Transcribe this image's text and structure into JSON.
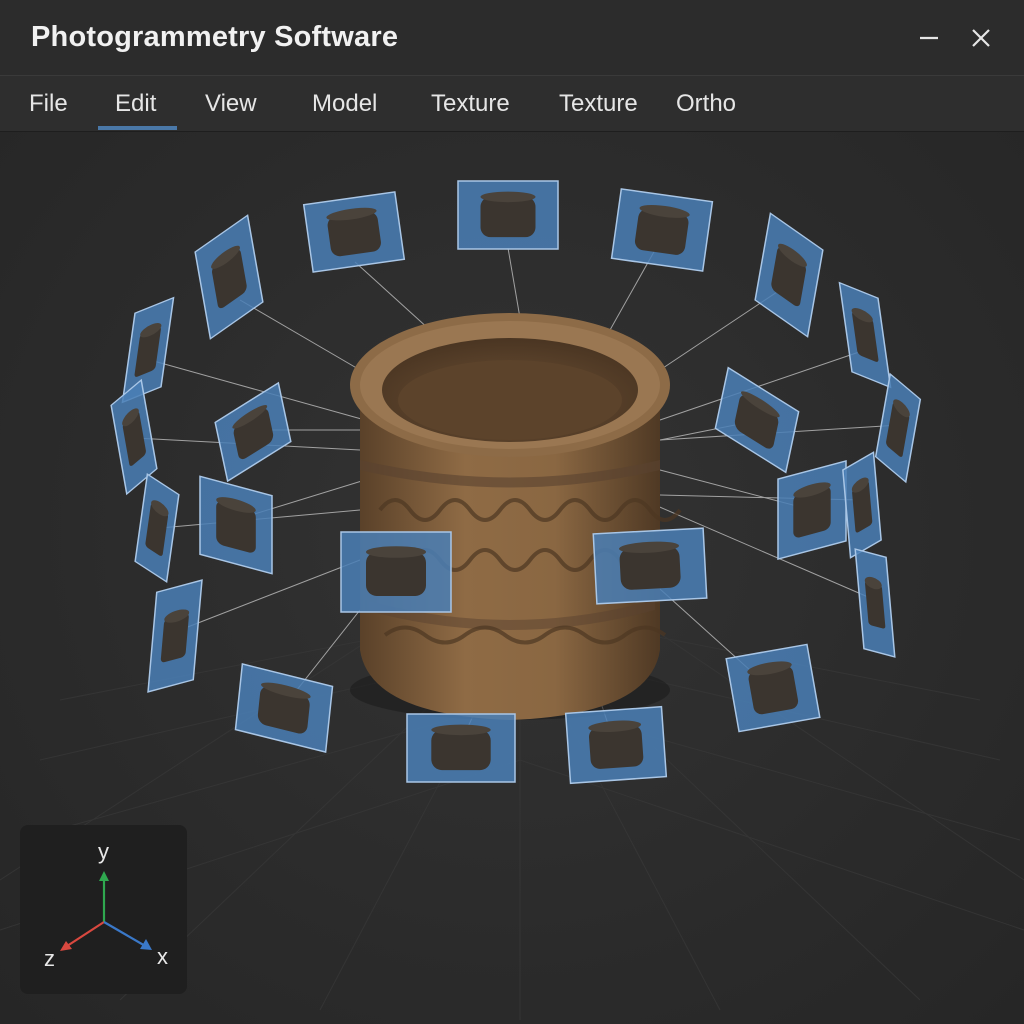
{
  "window": {
    "title": "Photogrammetry Software",
    "controls": [
      "minimize-icon",
      "close-icon"
    ]
  },
  "menu": {
    "items": [
      {
        "label": "File"
      },
      {
        "label": "Edit",
        "active": true
      },
      {
        "label": "View"
      },
      {
        "label": "Model"
      },
      {
        "label": "Texture"
      },
      {
        "label": "Texture"
      },
      {
        "label": "Ortho"
      }
    ]
  },
  "viewport": {
    "object": "stone-pot-model",
    "camera_count": 26,
    "camera_frame_color": "#4a7fb6"
  },
  "axis_widget": {
    "y_label": "y",
    "z_label": "z",
    "x_label": "x",
    "colors": {
      "y": "#2fa84f",
      "z": "#d9483f",
      "x": "#3a78c8"
    }
  }
}
